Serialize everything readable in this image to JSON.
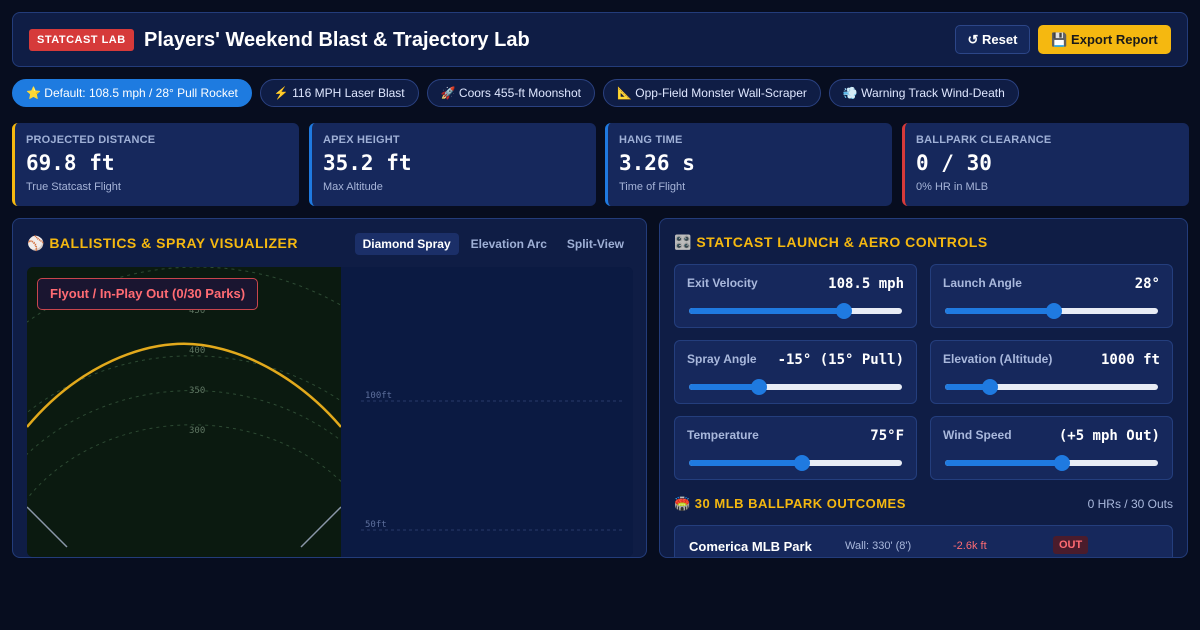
{
  "header": {
    "badge": "STATCAST LAB",
    "title": "Players' Weekend Blast & Trajectory Lab",
    "reset_label": "↺ Reset",
    "export_label": "💾 Export Report"
  },
  "presets": [
    {
      "label": "⭐ Default: 108.5 mph / 28° Pull Rocket",
      "active": true
    },
    {
      "label": "⚡ 116 MPH Laser Blast",
      "active": false
    },
    {
      "label": "🚀 Coors 455-ft Moonshot",
      "active": false
    },
    {
      "label": "📐 Opp-Field Monster Wall-Scraper",
      "active": false
    },
    {
      "label": "💨 Warning Track Wind-Death",
      "active": false
    }
  ],
  "metrics": [
    {
      "label": "PROJECTED DISTANCE",
      "value": "69.8 ft",
      "sub": "True Statcast Flight",
      "color": "#f5b810"
    },
    {
      "label": "APEX HEIGHT",
      "value": "35.2 ft",
      "sub": "Max Altitude",
      "color": "#1f7ae0"
    },
    {
      "label": "HANG TIME",
      "value": "3.26 s",
      "sub": "Time of Flight",
      "color": "#1f7ae0"
    },
    {
      "label": "BALLPARK CLEARANCE",
      "value": "0 / 30",
      "sub": "0% HR in MLB",
      "color": "#d63a3a"
    }
  ],
  "viz": {
    "title": "⚾ BALLISTICS & SPRAY VISUALIZER",
    "tabs": [
      {
        "label": "Diamond Spray",
        "active": true
      },
      {
        "label": "Elevation Arc",
        "active": false
      },
      {
        "label": "Split-View",
        "active": false
      }
    ],
    "outcome": "Flyout / In-Play Out (0/30 Parks)",
    "distance_rings": [
      "450",
      "400",
      "350",
      "300"
    ],
    "height_labels": [
      "100ft",
      "50ft"
    ]
  },
  "controls": {
    "title": "🎛️ STATCAST LAUNCH & AERO CONTROLS",
    "sliders": [
      {
        "label": "Exit Velocity",
        "value": "108.5 mph",
        "fraction": 0.73
      },
      {
        "label": "Launch Angle",
        "value": "28°",
        "fraction": 0.51
      },
      {
        "label": "Spray Angle",
        "value": "-15° (15° Pull)",
        "fraction": 0.33
      },
      {
        "label": "Elevation (Altitude)",
        "value": "1000 ft",
        "fraction": 0.21
      },
      {
        "label": "Temperature",
        "value": "75°F",
        "fraction": 0.53
      },
      {
        "label": "Wind Speed",
        "value": "(+5 mph Out)",
        "fraction": 0.55
      }
    ]
  },
  "outcomes": {
    "title": "🏟️ 30 MLB BALLPARK OUTCOMES",
    "summary": "0 HRs / 30 Outs",
    "rows": [
      {
        "name": "Comerica MLB Park",
        "wall": "Wall: 330' (8')",
        "diff": "-2.6k ft",
        "result": "OUT"
      }
    ]
  },
  "colors": {
    "accent": "#f5b810",
    "primary": "#1f7ae0",
    "danger": "#d63a3a",
    "panel": "#0f1d45",
    "background": "#070d1f"
  }
}
